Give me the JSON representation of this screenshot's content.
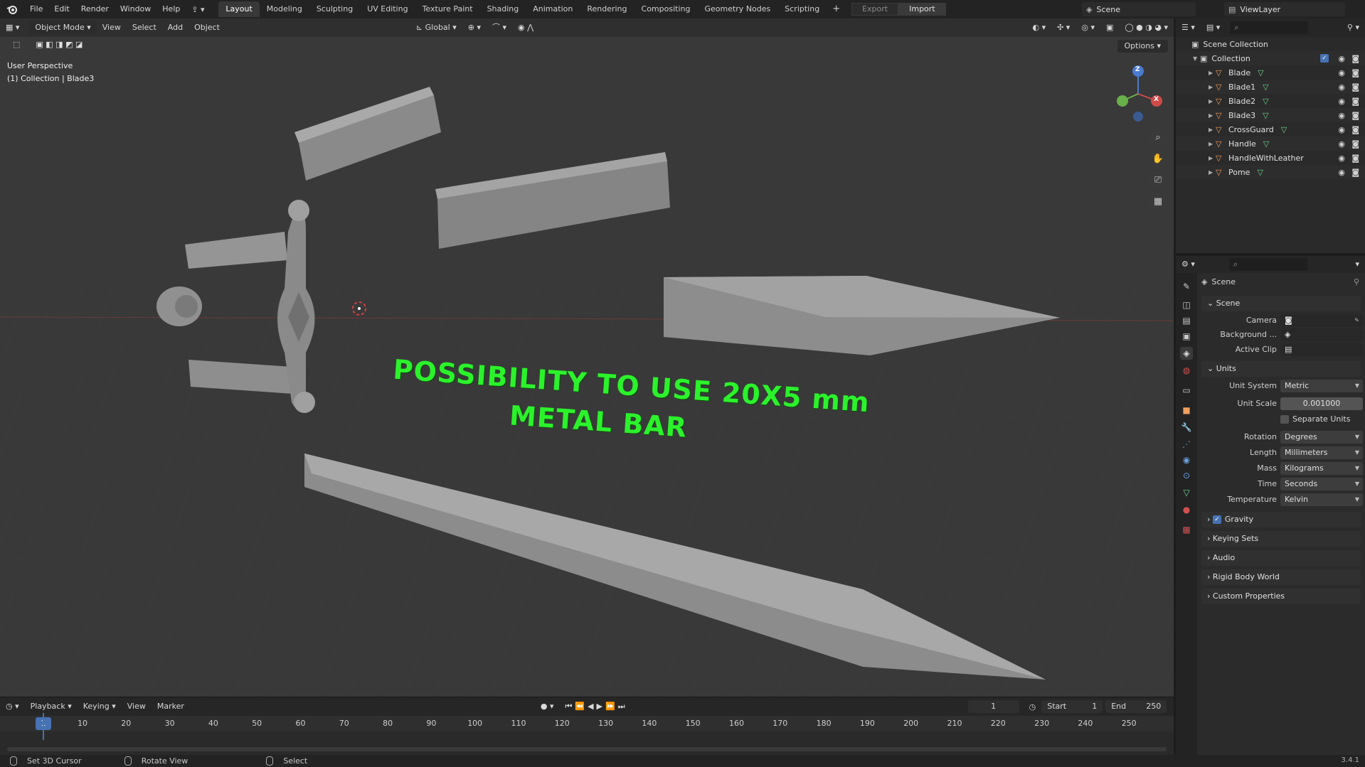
{
  "menu": {
    "items": [
      "File",
      "Edit",
      "Render",
      "Window",
      "Help"
    ],
    "workspaces": [
      "Layout",
      "Modeling",
      "Sculpting",
      "UV Editing",
      "Texture Paint",
      "Shading",
      "Animation",
      "Rendering",
      "Compositing",
      "Geometry Nodes",
      "Scripting"
    ],
    "active_workspace": "Layout",
    "plus": "+",
    "export": "Export",
    "import": "Import",
    "scene": "Scene",
    "view_layer": "ViewLayer"
  },
  "viewport": {
    "mode": "Object Mode",
    "menus": [
      "View",
      "Select",
      "Add",
      "Object"
    ],
    "orientation": "Global",
    "options": "Options",
    "perspective_label": "User Perspective",
    "selection_label": "(1) Collection | Blade3",
    "overlay_line1": "POSSIBILITY TO USE 20X5 mm",
    "overlay_line2": "METAL BAR",
    "gizmo": {
      "x": "X",
      "z": "Z"
    }
  },
  "outliner": {
    "scene_collection": "Scene Collection",
    "collection": "Collection",
    "objects": [
      "Blade",
      "Blade1",
      "Blade2",
      "Blade3",
      "CrossGuard",
      "Handle",
      "HandleWithLeather",
      "Pome"
    ]
  },
  "properties": {
    "context": "Scene",
    "scene_panel": {
      "title": "Scene",
      "camera_label": "Camera",
      "background_label": "Background ...",
      "active_clip_label": "Active Clip"
    },
    "units_panel": {
      "title": "Units",
      "rows": [
        {
          "label": "Unit System",
          "value": "Metric"
        },
        {
          "label": "Unit Scale",
          "value": "0.001000"
        },
        {
          "label": "",
          "value": "Separate Units"
        },
        {
          "label": "Rotation",
          "value": "Degrees"
        },
        {
          "label": "Length",
          "value": "Millimeters"
        },
        {
          "label": "Mass",
          "value": "Kilograms"
        },
        {
          "label": "Time",
          "value": "Seconds"
        },
        {
          "label": "Temperature",
          "value": "Kelvin"
        }
      ]
    },
    "collapsed_panels": [
      "Gravity",
      "Keying Sets",
      "Audio",
      "Rigid Body World",
      "Custom Properties"
    ]
  },
  "timeline": {
    "menus": [
      "Playback",
      "Keying",
      "View",
      "Marker"
    ],
    "current_frame": "1",
    "start_label": "Start",
    "start": "1",
    "end_label": "End",
    "end": "250",
    "ticks": [
      "10",
      "20",
      "30",
      "40",
      "50",
      "60",
      "70",
      "80",
      "90",
      "100",
      "110",
      "120",
      "130",
      "140",
      "150",
      "160",
      "170",
      "180",
      "190",
      "200",
      "210",
      "220",
      "230",
      "240",
      "250"
    ]
  },
  "status": {
    "set_cursor": "Set 3D Cursor",
    "rotate": "Rotate View",
    "select": "Select",
    "version": "3.4.1"
  },
  "colors": {
    "accent": "#4772b3",
    "overlay_text": "#2cf22c",
    "object_icon": "#f0a060",
    "mesh_icon": "#6fd48a"
  }
}
